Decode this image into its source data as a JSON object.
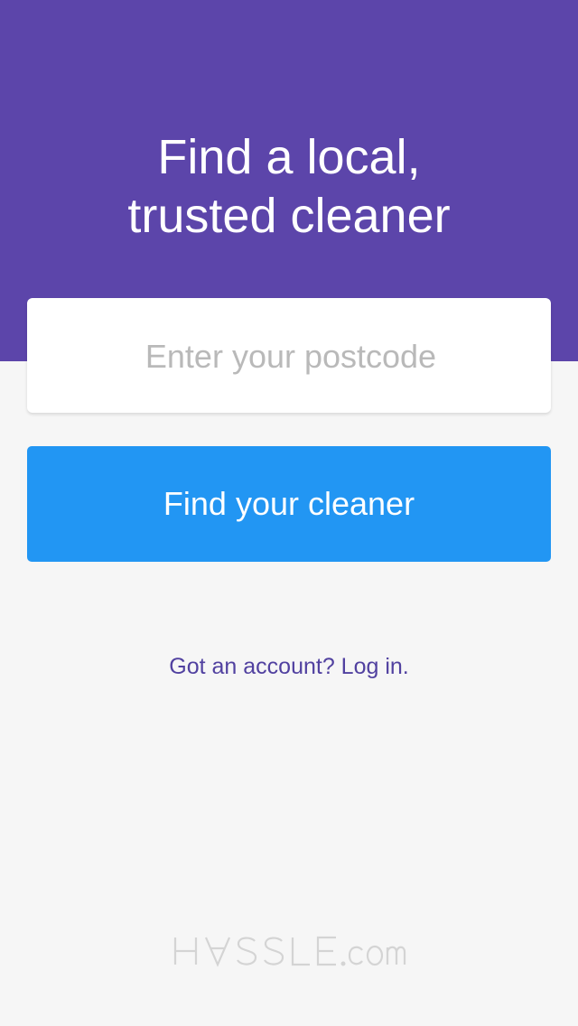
{
  "hero": {
    "title_line1": "Find a local,",
    "title_line2": "trusted cleaner",
    "background_color": "#5c45aa"
  },
  "search": {
    "placeholder": "Enter your postcode",
    "value": ""
  },
  "cta": {
    "label": "Find your cleaner",
    "color": "#2296f3"
  },
  "login": {
    "text": "Got an account? Log in."
  },
  "footer": {
    "logo_text": "HASSLE.com"
  }
}
